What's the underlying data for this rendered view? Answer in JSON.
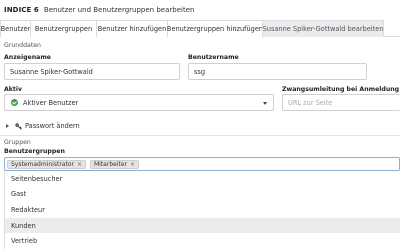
{
  "header": {
    "brand": "INDICE 6",
    "title": "Benutzer und Benutzergruppen bearbeiten"
  },
  "tabs": [
    {
      "label": "Benutzer"
    },
    {
      "label": "Benutzergruppen"
    },
    {
      "label": "Benutzer hinzufügen"
    },
    {
      "label": "Benutzergruppen hinzufügen"
    },
    {
      "label": "Susanne Spiker-Gottwald bearbeiten",
      "active": true
    }
  ],
  "grunddaten": {
    "section_label": "Grunddaten",
    "display_name_label": "Anzeigename",
    "display_name_value": "Susanne Spiker-Gottwald",
    "username_label": "Benutzername",
    "username_value": "ssg",
    "active_label": "Aktiv",
    "active_value": "Aktiver Benutzer",
    "redirect_label": "Zwangsumleitung bei Anmeldung",
    "redirect_placeholder": "URL zur Seite",
    "password_toggle": "Passwort ändern"
  },
  "gruppen": {
    "section_label": "Gruppen",
    "groups_label": "Benutzergruppen",
    "selected": [
      {
        "label": "Systemadministrator",
        "remove": "×"
      },
      {
        "label": "Mitarbeiter",
        "remove": "×"
      }
    ],
    "options": [
      {
        "label": "Seitenbesucher"
      },
      {
        "label": "Gast"
      },
      {
        "label": "Redakteur"
      },
      {
        "label": "Kunden",
        "highlighted": true
      },
      {
        "label": "Vertrieb"
      }
    ]
  },
  "colors": {
    "active_check": "#3c9c4d",
    "tag_border": "#8fb0d6",
    "active_tab_bg": "#e9ebee",
    "highlight_bg": "#ececec"
  }
}
